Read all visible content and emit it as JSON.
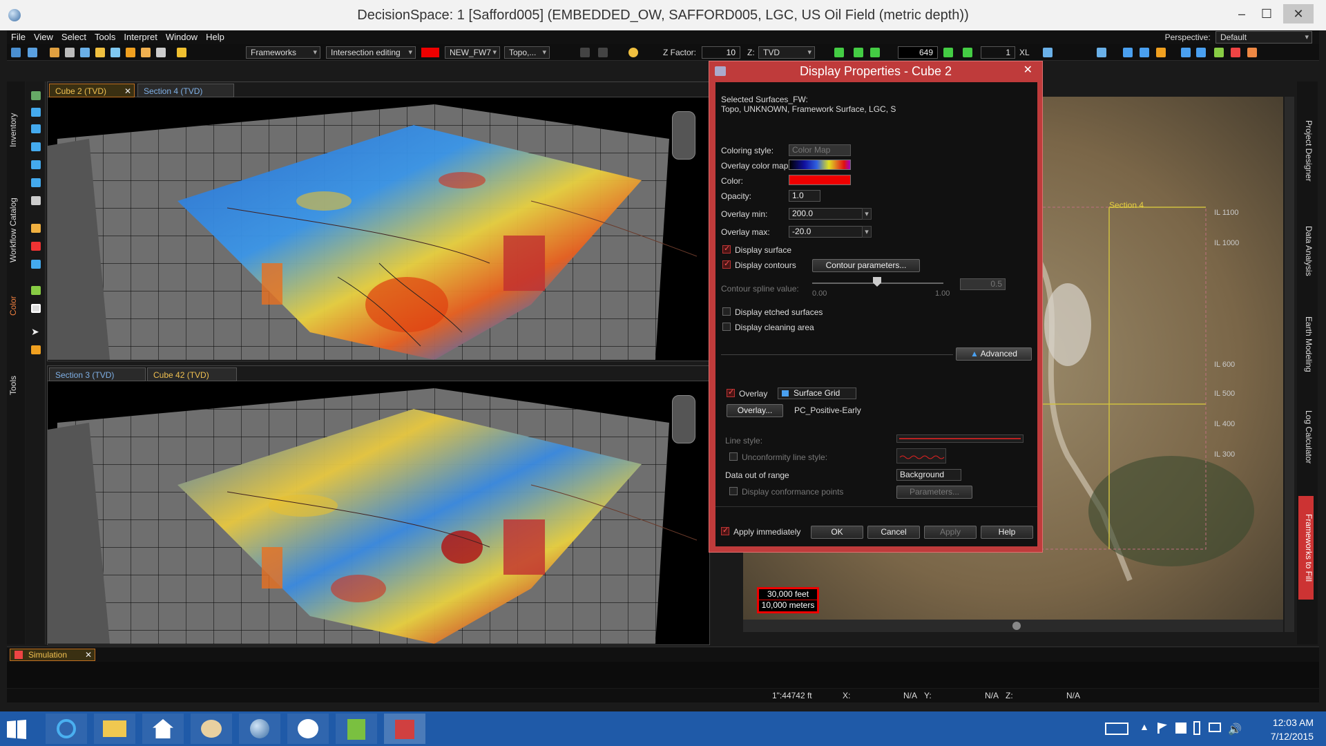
{
  "window": {
    "title": "DecisionSpace: 1 [Safford005] (EMBEDDED_OW, SAFFORD005, LGC, US Oil Field (metric depth))"
  },
  "menu": {
    "items": [
      "File",
      "View",
      "Select",
      "Tools",
      "Interpret",
      "Window",
      "Help"
    ],
    "perspective_label": "Perspective:",
    "perspective_value": "Default"
  },
  "toolbar": {
    "frameworks": "Frameworks",
    "intersection": "Intersection editing",
    "framework_name": "NEW_FW7",
    "surface": "Topo,...",
    "zfactor_label": "Z Factor:",
    "zfactor_value": "10",
    "z_label": "Z:",
    "z_value": "TVD",
    "slice_value": "649",
    "step_value": "1",
    "xl_label": "XL"
  },
  "left_tabs": [
    "Inventory",
    "Workflow Catalog",
    "Color",
    "Tools"
  ],
  "right_tabs": [
    "Project Designer",
    "Data Analysis",
    "Earth Modeling",
    "Log Calculator",
    "Frameworks to Fill"
  ],
  "views": {
    "top_tabs": [
      "Cube 2 (TVD)",
      "Section 4 (TVD)"
    ],
    "bottom_tabs": [
      "Section 3 (TVD)",
      "Cube 42 (TVD)"
    ]
  },
  "map": {
    "section_label": "Section 4",
    "il_labels": [
      "IL 1100",
      "IL 1000",
      "IL 600",
      "IL 500",
      "IL 400",
      "IL 300"
    ],
    "scale_feet": "30,000 feet",
    "scale_meters": "10,000 meters"
  },
  "dialog": {
    "title": "Display Properties - Cube 2",
    "selected_label": "Selected Surfaces_FW:",
    "selected_value": "Topo, UNKNOWN, Framework Surface, LGC, S",
    "coloring_label": "Coloring style:",
    "coloring_value": "Color Map",
    "overlay_map_label": "Overlay color map:",
    "color_label": "Color:",
    "opacity_label": "Opacity:",
    "opacity_value": "1.0",
    "overlay_min_label": "Overlay min:",
    "overlay_min_value": "200.0",
    "overlay_max_label": "Overlay max:",
    "overlay_max_value": "-20.0",
    "display_surface": "Display surface",
    "display_contours": "Display contours",
    "contour_params": "Contour parameters...",
    "spline_label": "Contour spline value:",
    "spline_min": "0.00",
    "spline_max": "1.00",
    "spline_value": "0.5",
    "etched": "Display etched surfaces",
    "cleaning": "Display cleaning area",
    "advanced": "Advanced",
    "overlay_label": "Overlay",
    "overlay_type": "Surface Grid",
    "overlay_button": "Overlay...",
    "overlay_name": "PC_Positive-Early",
    "line_style": "Line style:",
    "unconformity": "Unconformity line style:",
    "out_of_range": "Data out of range",
    "out_of_range_value": "Background",
    "conformance": "Display conformance points",
    "parameters": "Parameters...",
    "apply_immediately": "Apply immediately",
    "ok": "OK",
    "cancel": "Cancel",
    "apply": "Apply",
    "help": "Help"
  },
  "bottom_panel": {
    "tab": "Simulation"
  },
  "status": {
    "scale": "1\":44742 ft",
    "x_label": "X:",
    "x_value": "N/A",
    "y_label": "Y:",
    "y_value": "N/A",
    "z_label": "Z:",
    "z_value": "N/A"
  },
  "taskbar": {
    "time": "12:03 AM",
    "date": "7/12/2015"
  },
  "colors": {
    "accent_red": "#c0392b",
    "dialog_red": "#bf3b3b",
    "tab_orange": "#f0c050",
    "taskbar": "#1f5aa8"
  }
}
